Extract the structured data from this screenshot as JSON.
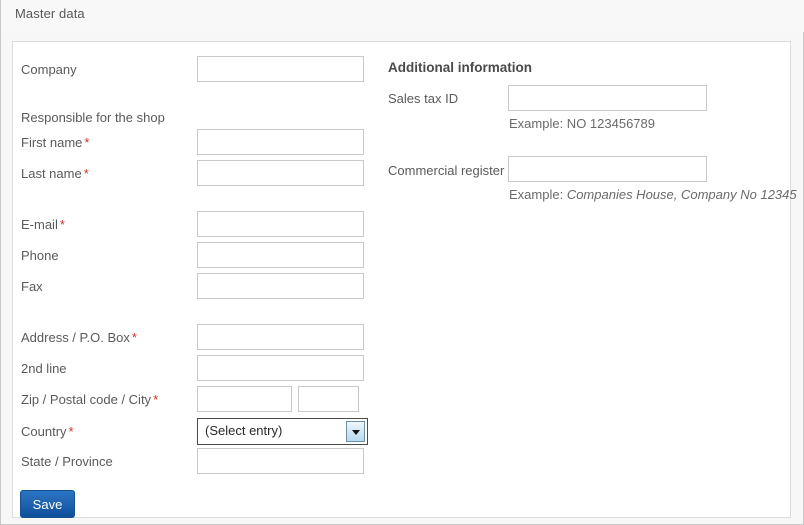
{
  "window": {
    "title": "Master data"
  },
  "form": {
    "company": {
      "label": "Company",
      "value": "",
      "placeholder": ""
    },
    "responsible_section_label": "Responsible for the shop",
    "first_name": {
      "label": "First name",
      "required_marker": "*",
      "value": "",
      "placeholder": ""
    },
    "last_name": {
      "label": "Last name",
      "required_marker": "*",
      "value": "",
      "placeholder": ""
    },
    "email": {
      "label": "E-mail",
      "required_marker": "*",
      "value": "",
      "placeholder": ""
    },
    "phone": {
      "label": "Phone",
      "value": "",
      "placeholder": ""
    },
    "fax": {
      "label": "Fax",
      "value": "",
      "placeholder": ""
    },
    "address": {
      "label": "Address / P.O. Box",
      "required_marker": "*",
      "value": "",
      "placeholder": ""
    },
    "second_line": {
      "label": "2nd line",
      "value": "",
      "placeholder": ""
    },
    "zip_city": {
      "label": "Zip / Postal code / City",
      "required_marker": "*",
      "zip_value": "",
      "zip_placeholder": "",
      "city_value": "",
      "city_placeholder": ""
    },
    "country": {
      "label": "Country",
      "required_marker": "*",
      "selected": "(Select entry)",
      "options": [
        "(Select entry)"
      ]
    },
    "state": {
      "label": "State / Province",
      "value": "",
      "placeholder": ""
    },
    "save_button": "Save"
  },
  "additional": {
    "heading": "Additional information",
    "sales_tax_id": {
      "label": "Sales tax ID",
      "value": "",
      "placeholder": "",
      "hint_prefix": "Example: NO 123456789"
    },
    "commercial_register": {
      "label": "Commercial register",
      "value": "",
      "placeholder": "",
      "hint_prefix": "Example: ",
      "hint_italic": "Companies House, Company No 12345"
    }
  },
  "colors": {
    "label_text": "#5a5a5a",
    "required_marker": "#cc3322",
    "input_border": "#c9c9c9",
    "panel_border": "#dcdcdc",
    "save_button": "#1f62ae",
    "heading_text": "#4a4a4a"
  }
}
